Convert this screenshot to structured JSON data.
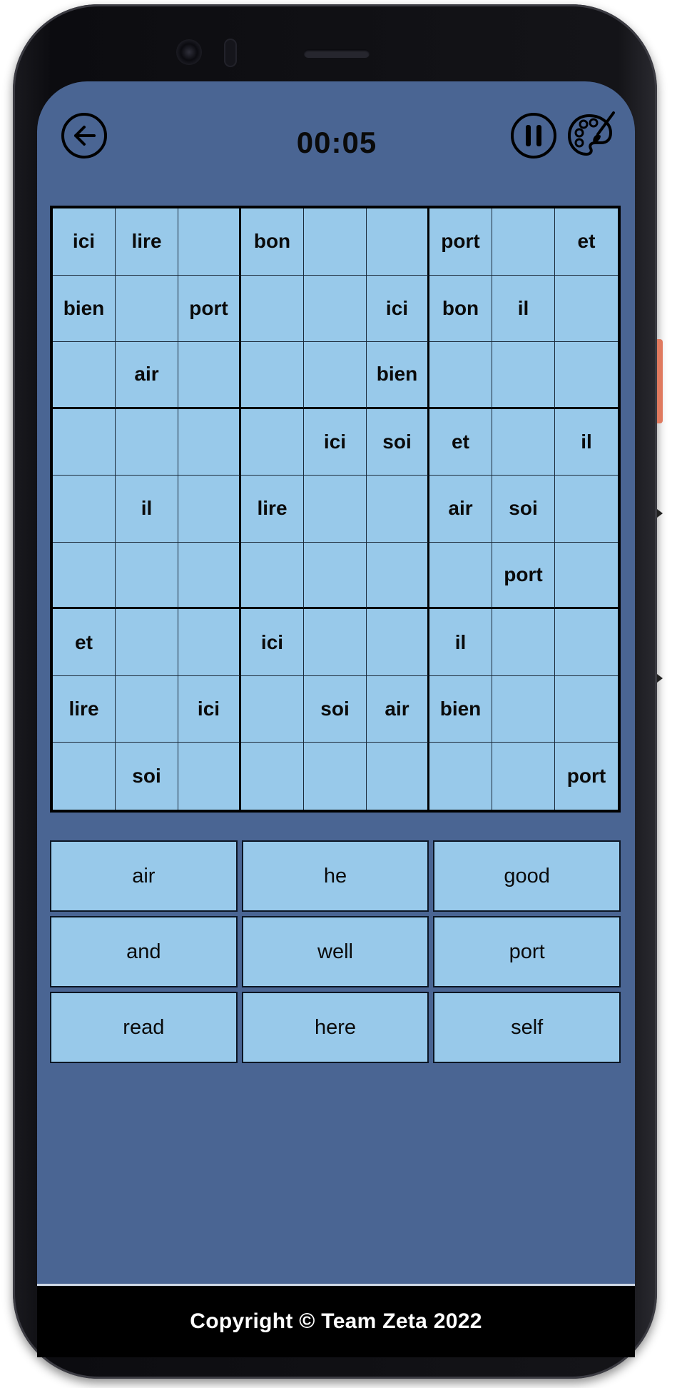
{
  "header": {
    "timer": "00:05",
    "back_icon": "arrow-left-circle-icon",
    "pause_icon": "pause-circle-icon",
    "theme_icon": "palette-brush-icon"
  },
  "board": {
    "rows": [
      [
        "ici",
        "lire",
        "",
        "bon",
        "",
        "",
        "port",
        "",
        "et"
      ],
      [
        "bien",
        "",
        "port",
        "",
        "",
        "ici",
        "bon",
        "il",
        ""
      ],
      [
        "",
        "air",
        "",
        "",
        "",
        "bien",
        "",
        "",
        ""
      ],
      [
        "",
        "",
        "",
        "",
        "ici",
        "soi",
        "et",
        "",
        "il"
      ],
      [
        "",
        "il",
        "",
        "lire",
        "",
        "",
        "air",
        "soi",
        ""
      ],
      [
        "",
        "",
        "",
        "",
        "",
        "",
        "",
        "port",
        ""
      ],
      [
        "et",
        "",
        "",
        "ici",
        "",
        "",
        "il",
        "",
        ""
      ],
      [
        "lire",
        "",
        "ici",
        "",
        "soi",
        "air",
        "bien",
        "",
        ""
      ],
      [
        "",
        "soi",
        "",
        "",
        "",
        "",
        "",
        "",
        "port"
      ]
    ]
  },
  "choices": [
    "air",
    "he",
    "good",
    "and",
    "well",
    "port",
    "read",
    "here",
    "self"
  ],
  "footer": {
    "copyright": "Copyright © Team Zeta 2022"
  },
  "colors": {
    "screen_bg": "#4a6593",
    "cell_bg": "#98c9ea",
    "side_button": "#e07a5f"
  }
}
